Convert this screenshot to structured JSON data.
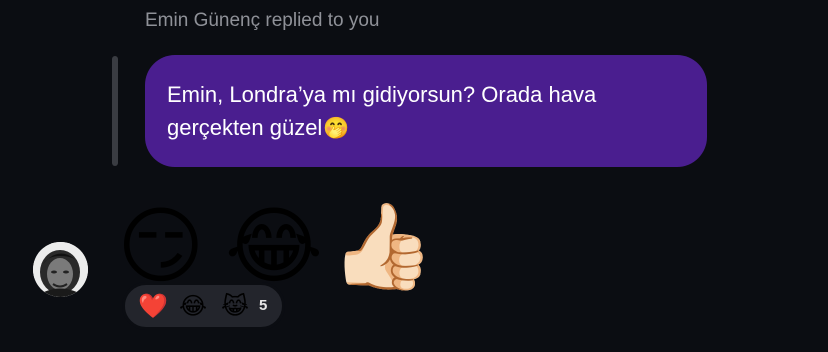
{
  "reply": {
    "header": "Emin Günenç replied to you",
    "text": "Emin, Londra’ya mı gidiyorsun? Orada hava gerçekten güzel",
    "emoji": "🤭"
  },
  "message": {
    "emojis": [
      "😏",
      "😂",
      "👍🏻"
    ]
  },
  "reactions": {
    "items": [
      "❤️",
      "😂",
      "😹"
    ],
    "count": "5"
  },
  "colors": {
    "background": "#0b0d12",
    "bubble": "#4a1e8f",
    "reaction_pill": "#23252c"
  }
}
